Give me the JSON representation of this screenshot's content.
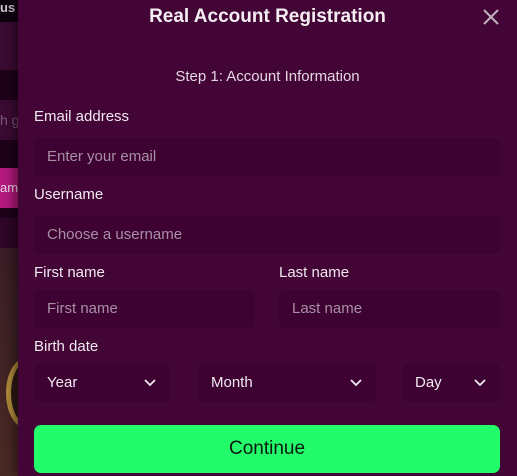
{
  "background": {
    "fragment_top": "us",
    "fragment_search": "h g",
    "fragment_button": "am"
  },
  "modal": {
    "title": "Real Account Registration",
    "step": "Step 1: Account Information",
    "email": {
      "label": "Email address",
      "placeholder": "Enter your email"
    },
    "username": {
      "label": "Username",
      "placeholder": "Choose a username"
    },
    "first_name": {
      "label": "First name",
      "placeholder": "First name"
    },
    "last_name": {
      "label": "Last name",
      "placeholder": "Last name"
    },
    "birth_date": {
      "label": "Birth date",
      "year": "Year",
      "month": "Month",
      "day": "Day"
    },
    "continue_label": "Continue"
  },
  "colors": {
    "modal_bg": "#420535",
    "field_bg": "#3e0232",
    "continue_bg": "#22fb6a"
  },
  "icons": {
    "close": "close-icon",
    "dropdown": "chevron-down-icon"
  }
}
